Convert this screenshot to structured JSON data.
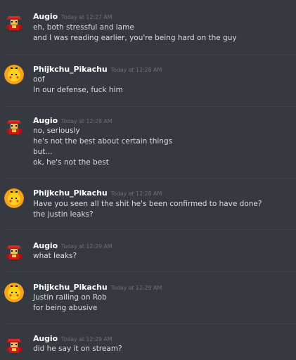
{
  "messages": [
    {
      "author": "Augio",
      "timestamp": "Today at 12:27 AM",
      "avatar": "pixel-character-avatar",
      "lines": [
        "eh, both stressful and lame",
        "and I was reading earlier, you're being hard on the guy"
      ]
    },
    {
      "author": "Phijkchu_Pikachu",
      "timestamp": "Today at 12:28 AM",
      "avatar": "pikachu-avatar",
      "lines": [
        "oof",
        "In our defense, fuck him"
      ]
    },
    {
      "author": "Augio",
      "timestamp": "Today at 12:28 AM",
      "avatar": "pixel-character-avatar",
      "lines": [
        "no, seriously",
        "he's not the best about certain things",
        "but...",
        "ok, he's not the best"
      ]
    },
    {
      "author": "Phijkchu_Pikachu",
      "timestamp": "Today at 12:28 AM",
      "avatar": "pikachu-avatar",
      "lines": [
        "Have you seen all the shit he's been confirmed to have done?",
        "the justin leaks?"
      ]
    },
    {
      "author": "Augio",
      "timestamp": "Today at 12:29 AM",
      "avatar": "pixel-character-avatar",
      "lines": [
        "what leaks?"
      ]
    },
    {
      "author": "Phijkchu_Pikachu",
      "timestamp": "Today at 12:29 AM",
      "avatar": "pikachu-avatar",
      "lines": [
        "Justin railing on Rob",
        "for being abusive"
      ]
    },
    {
      "author": "Augio",
      "timestamp": "Today at 12:29 AM",
      "avatar": "pixel-character-avatar",
      "lines": [
        "did he say it on stream?"
      ]
    }
  ],
  "colors": {
    "background": "#36393f",
    "username": "#ffffff",
    "timestamp": "#6c7079",
    "message_text": "#dcddde",
    "divider": "#40434a"
  }
}
